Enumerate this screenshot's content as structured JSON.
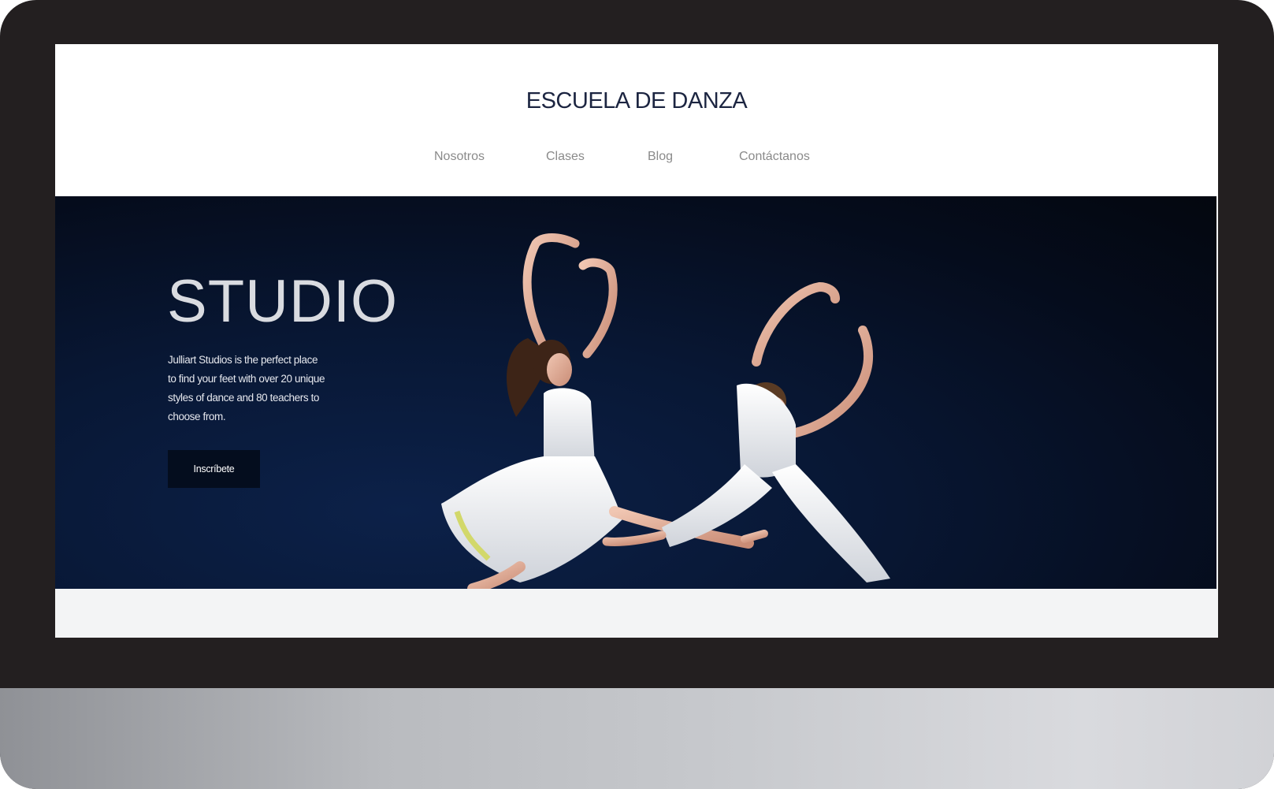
{
  "site": {
    "title": "ESCUELA DE DANZA"
  },
  "nav": {
    "items": [
      {
        "label": "Nosotros"
      },
      {
        "label": "Clases"
      },
      {
        "label": "Blog"
      },
      {
        "label": "Contáctanos"
      }
    ]
  },
  "hero": {
    "title": "STUDIO",
    "description": "Julliart Studios is the perfect place to find your feet with over 20 unique styles of dance and 80 teachers to choose from.",
    "button_label": "Inscríbete",
    "image_subject": "two dancers in white mid-leap"
  },
  "colors": {
    "frame": "#231f20",
    "title": "#1c2541",
    "nav_text": "#8a8a8a",
    "hero_background": "#081734",
    "button": "#040d1e"
  }
}
